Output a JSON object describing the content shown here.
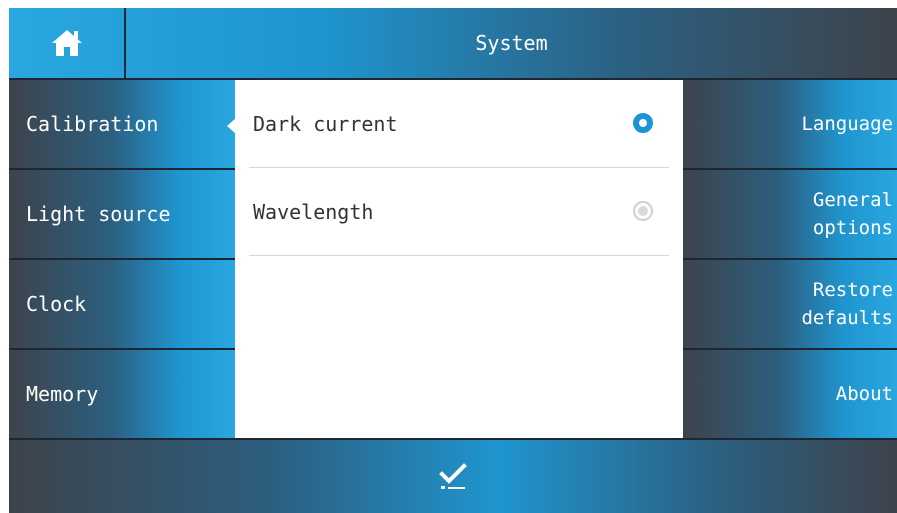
{
  "header": {
    "title": "System",
    "home_icon": "home-icon"
  },
  "left_menu": {
    "items": [
      {
        "label": "Calibration",
        "active": true
      },
      {
        "label": "Light source",
        "active": false
      },
      {
        "label": "Clock",
        "active": false
      },
      {
        "label": "Memory",
        "active": false
      }
    ]
  },
  "options": {
    "items": [
      {
        "label": "Dark current",
        "selected": true
      },
      {
        "label": "Wavelength",
        "selected": false
      }
    ]
  },
  "right_menu": {
    "items": [
      {
        "label": "Language"
      },
      {
        "label": "General\noptions"
      },
      {
        "label": "Restore\ndefaults"
      },
      {
        "label": "About"
      }
    ]
  },
  "footer": {
    "confirm_icon": "checkmark-icon"
  },
  "colors": {
    "accent": "#1a95d8",
    "panel_dark": "#3d434b"
  }
}
